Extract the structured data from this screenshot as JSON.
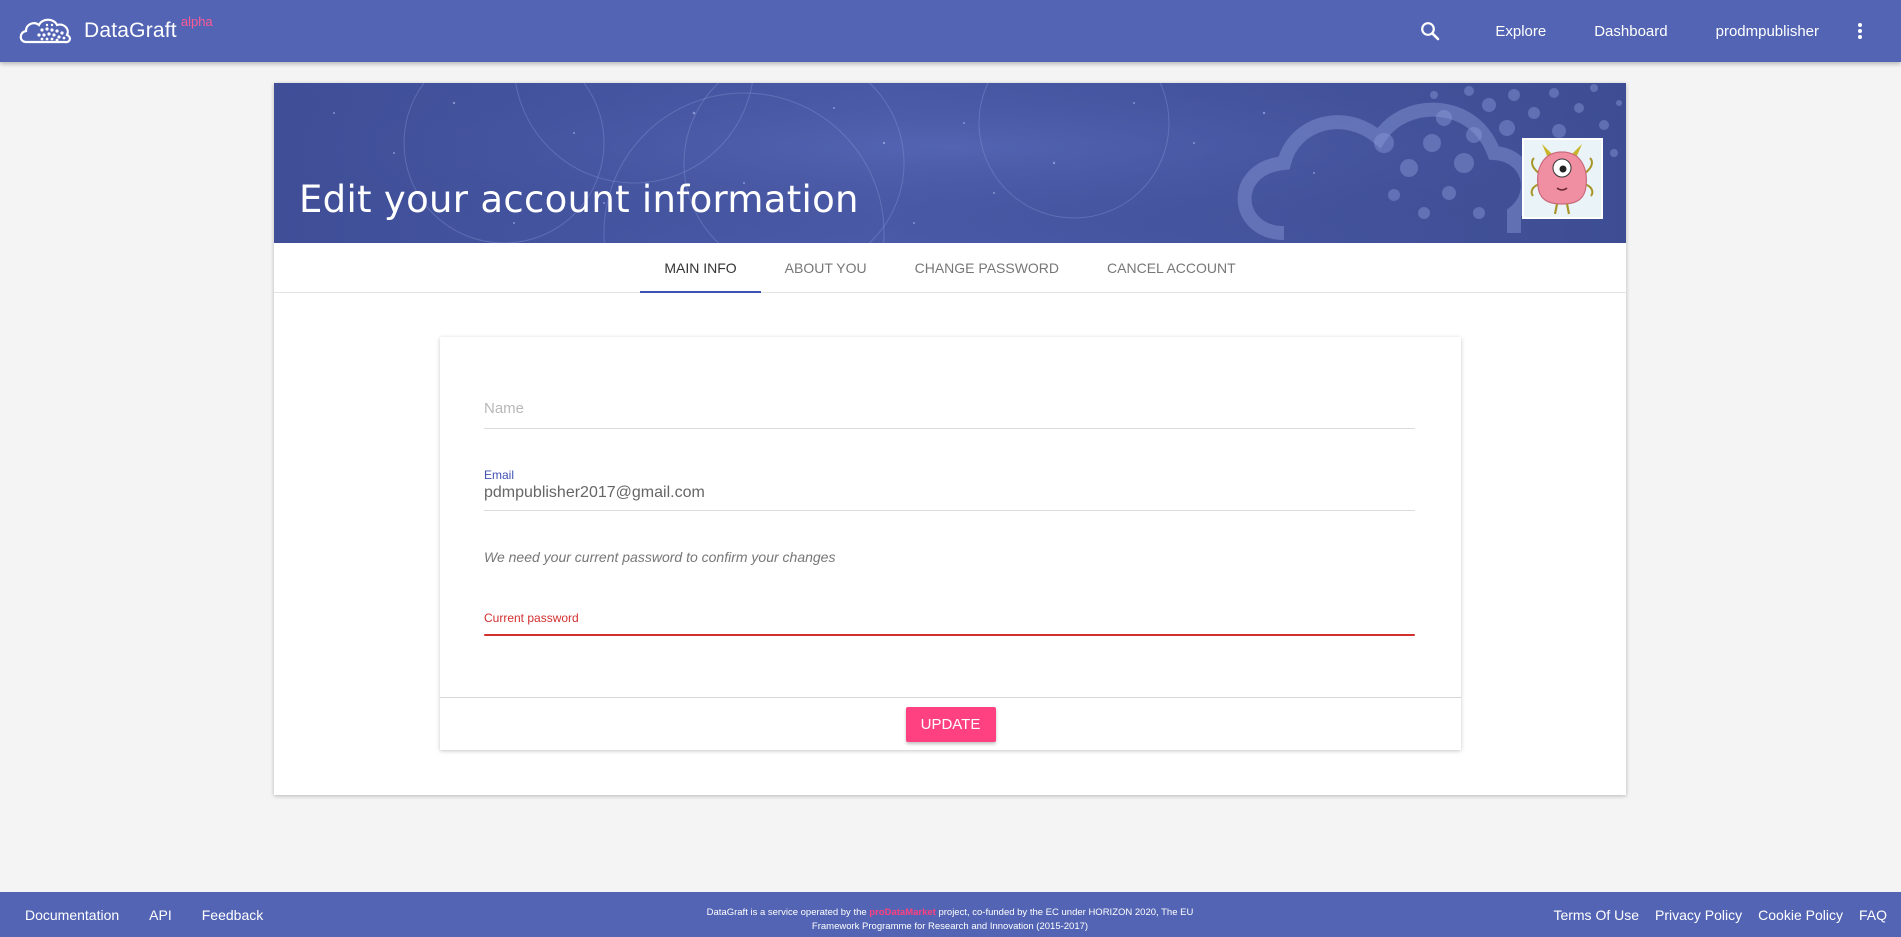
{
  "header": {
    "brand_name": "DataGraft",
    "brand_badge": "alpha",
    "nav": [
      "Explore",
      "Dashboard",
      "prodmpublisher"
    ],
    "icons": {
      "logo": "cloud-logo-icon",
      "search": "search-icon",
      "more": "more-vert-icon"
    }
  },
  "banner": {
    "title": "Edit your account information",
    "avatar": "monster-avatar"
  },
  "tabs": [
    {
      "label": "MAIN INFO",
      "active": true
    },
    {
      "label": "ABOUT YOU",
      "active": false
    },
    {
      "label": "CHANGE PASSWORD",
      "active": false
    },
    {
      "label": "CANCEL ACCOUNT",
      "active": false
    }
  ],
  "form": {
    "name_placeholder": "Name",
    "email_label": "Email",
    "email_value": "pdmpublisher2017@gmail.com",
    "hint": "We need your current password to confirm your changes",
    "password_label": "Current password",
    "update_label": "UPDATE"
  },
  "footer": {
    "left_links": [
      "Documentation",
      "API",
      "Feedback"
    ],
    "center_text_1": "DataGraft is a service operated by the ",
    "center_highlight": "proDataMarket",
    "center_text_2": " project, co-funded by the EC under HORIZON 2020, The EU Framework Programme for Research and Innovation (2015-2017)",
    "right_links": [
      "Terms Of Use",
      "Privacy Policy",
      "Cookie Policy",
      "FAQ"
    ]
  },
  "colors": {
    "primary": "#5264b3",
    "accent": "#ff4081",
    "error": "#d32f2f",
    "tab_indicator": "#3f51b5"
  }
}
